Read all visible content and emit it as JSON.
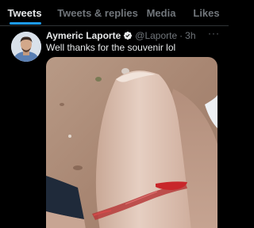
{
  "tabs": [
    {
      "label": "Tweets",
      "active": true
    },
    {
      "label": "Tweets & replies",
      "active": false
    },
    {
      "label": "Media",
      "active": false
    },
    {
      "label": "Likes",
      "active": false
    }
  ],
  "tweet": {
    "author_name": "Aymeric Laporte",
    "handle": "@Laporte",
    "separator": "·",
    "time": "3h",
    "text": "Well thanks for the souvenir lol",
    "more_label": "···",
    "verified_icon": "verified-badge-icon"
  },
  "colors": {
    "background": "#000000",
    "accent": "#1d9bf0",
    "primary_text": "#e7e9ea",
    "secondary_text": "#71767b",
    "divider": "#2f3336"
  }
}
